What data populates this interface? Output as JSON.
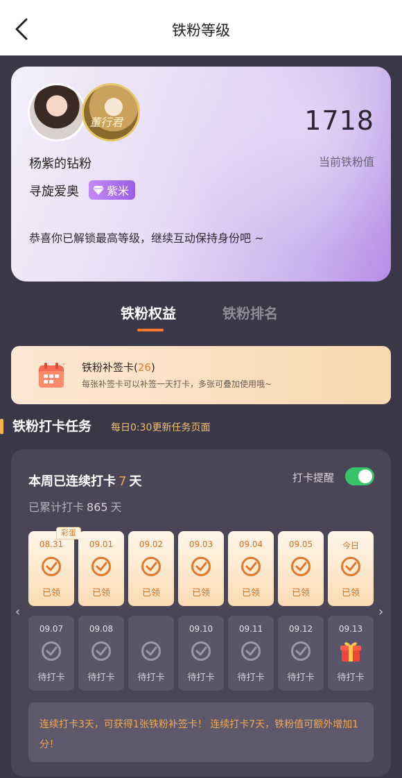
{
  "header": {
    "title": "铁粉等级"
  },
  "profile": {
    "fan_name": "杨紫的钻粉",
    "group_name": "寻旋爱奥",
    "badge_label": "紫米",
    "score": "1718",
    "score_label": "当前铁粉值",
    "congrats": "恭喜你已解锁最高等级，继续互动保持身份吧 ~",
    "avatar2_text": "董行君"
  },
  "tabs": {
    "benefits": "铁粉权益",
    "rank": "铁粉排名"
  },
  "makeup_card": {
    "title": "铁粉补签卡(",
    "count": "26",
    "title_end": ")",
    "desc": "每张补签卡可以补签一天打卡，多张可叠加使用哦~"
  },
  "section": {
    "title": "铁粉打卡任务",
    "subtitle": "每日0:30更新任务页面"
  },
  "checkin": {
    "streak_prefix": "本周已连续打卡",
    "streak_days": "7",
    "streak_unit": "天",
    "total_prefix": "已累计打卡",
    "total_days": "865",
    "total_unit": "天",
    "remind_label": "打卡提醒",
    "remind_on": true,
    "egg_label": "彩蛋",
    "week1": [
      {
        "date": "08.31",
        "status": "已领"
      },
      {
        "date": "09.01",
        "status": "已领"
      },
      {
        "date": "09.02",
        "status": "已领"
      },
      {
        "date": "09.03",
        "status": "已领"
      },
      {
        "date": "09.04",
        "status": "已领"
      },
      {
        "date": "09.05",
        "status": "已领"
      },
      {
        "date": "今日",
        "status": "已领"
      }
    ],
    "week2": [
      {
        "date": "09.07",
        "status": "待打卡"
      },
      {
        "date": "09.08",
        "status": "待打卡"
      },
      {
        "date": "",
        "status": "待打卡"
      },
      {
        "date": "09.10",
        "status": "待打卡"
      },
      {
        "date": "09.11",
        "status": "待打卡"
      },
      {
        "date": "09.12",
        "status": "待打卡"
      },
      {
        "date": "09.13",
        "status": "待打卡"
      }
    ],
    "note": "连续打卡3天，可获得1张铁粉补签卡！ 连续打卡7天，铁粉值可额外增加1分！"
  },
  "colors": {
    "accent": "#ff7a2f",
    "toggle_on": "#38c46a",
    "orange_text": "#f2a857"
  }
}
